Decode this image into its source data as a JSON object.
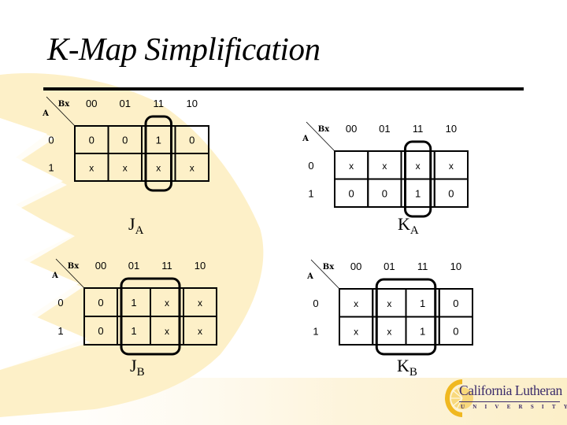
{
  "slide": {
    "title": "K-Map Simplification",
    "colors": {
      "accent_gold": "#f5c842",
      "watermark": "#fdf0c8",
      "logo_purple": "#3a2a6a",
      "ink": "#000000"
    }
  },
  "logo": {
    "name": "California Lutheran",
    "subtitle": "UNIVERSITY"
  },
  "maps": [
    {
      "id": "JA",
      "label_main": "J",
      "label_sub": "A",
      "row_var": "A",
      "col_var": "Bx",
      "col_headers": [
        "00",
        "01",
        "11",
        "10"
      ],
      "row_headers": [
        "0",
        "1"
      ],
      "cells": [
        [
          "0",
          "0",
          "1",
          "0"
        ],
        [
          "x",
          "x",
          "x",
          "x"
        ]
      ],
      "groups": [
        {
          "cols": [
            "11"
          ],
          "rows": [
            "0",
            "1"
          ]
        }
      ]
    },
    {
      "id": "KA",
      "label_main": "K",
      "label_sub": "A",
      "row_var": "A",
      "col_var": "Bx",
      "col_headers": [
        "00",
        "01",
        "11",
        "10"
      ],
      "row_headers": [
        "0",
        "1"
      ],
      "cells": [
        [
          "x",
          "x",
          "x",
          "x"
        ],
        [
          "0",
          "0",
          "1",
          "0"
        ]
      ],
      "groups": [
        {
          "cols": [
            "11"
          ],
          "rows": [
            "0",
            "1"
          ]
        }
      ]
    },
    {
      "id": "JB",
      "label_main": "J",
      "label_sub": "B",
      "row_var": "A",
      "col_var": "Bx",
      "col_headers": [
        "00",
        "01",
        "11",
        "10"
      ],
      "row_headers": [
        "0",
        "1"
      ],
      "cells": [
        [
          "0",
          "1",
          "x",
          "x"
        ],
        [
          "0",
          "1",
          "x",
          "x"
        ]
      ],
      "groups": [
        {
          "cols": [
            "01",
            "11"
          ],
          "rows": [
            "0",
            "1"
          ]
        }
      ]
    },
    {
      "id": "KB",
      "label_main": "K",
      "label_sub": "B",
      "row_var": "A",
      "col_var": "Bx",
      "col_headers": [
        "00",
        "01",
        "11",
        "10"
      ],
      "row_headers": [
        "0",
        "1"
      ],
      "cells": [
        [
          "x",
          "x",
          "1",
          "0"
        ],
        [
          "x",
          "x",
          "1",
          "0"
        ]
      ],
      "groups": [
        {
          "cols": [
            "01",
            "11"
          ],
          "rows": [
            "0",
            "1"
          ]
        }
      ]
    }
  ]
}
